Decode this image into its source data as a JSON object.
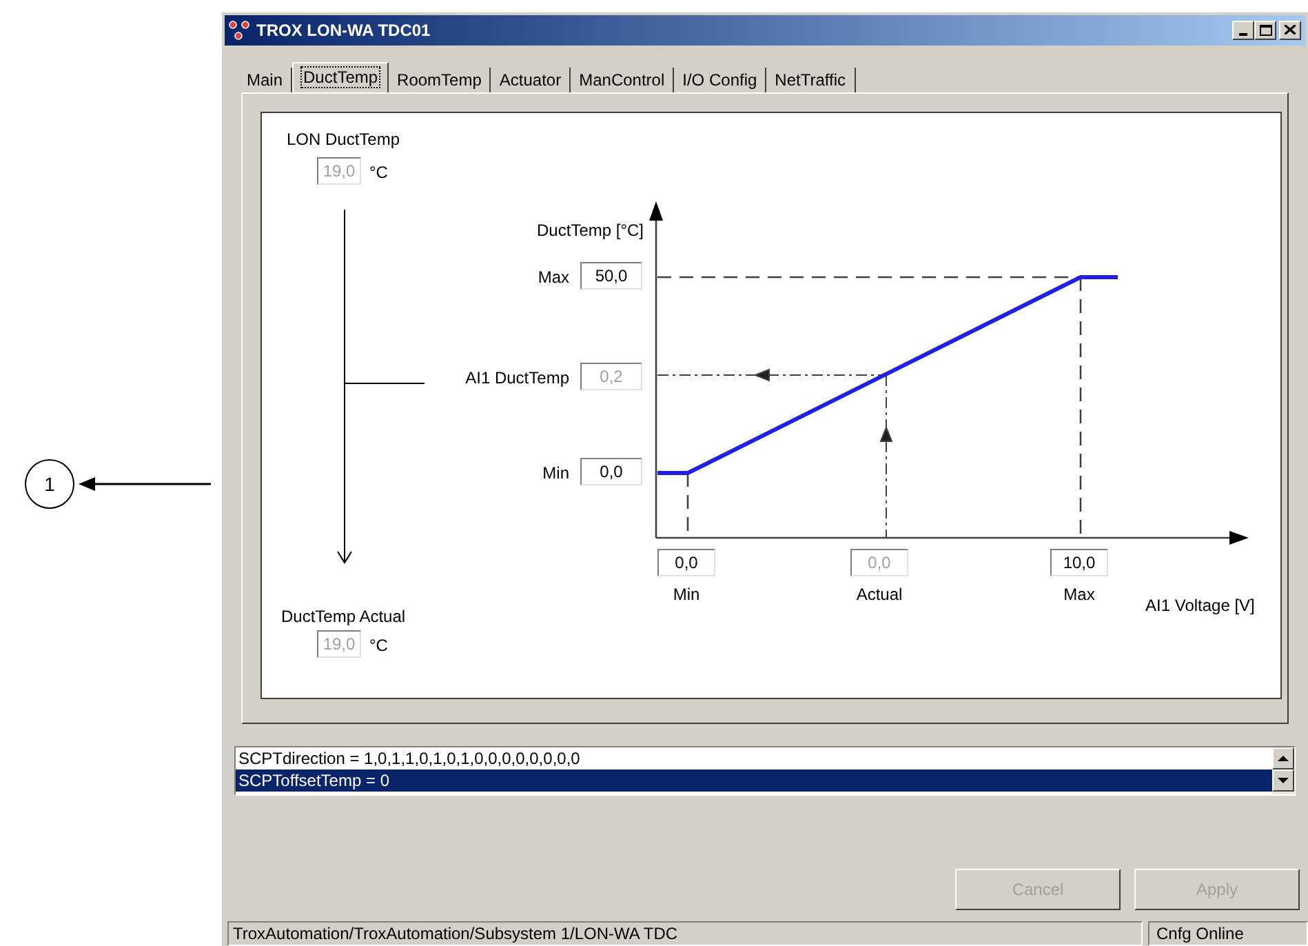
{
  "callout": {
    "label": "1"
  },
  "window": {
    "title": "TROX LON-WA TDC01"
  },
  "tabs": [
    {
      "label": "Main",
      "selected": false
    },
    {
      "label": "DuctTemp",
      "selected": true
    },
    {
      "label": "RoomTemp",
      "selected": false
    },
    {
      "label": "Actuator",
      "selected": false
    },
    {
      "label": "ManControl",
      "selected": false
    },
    {
      "label": "I/O Config",
      "selected": false
    },
    {
      "label": "NetTraffic",
      "selected": false
    }
  ],
  "duct_temp": {
    "lon": {
      "label": "LON DuctTemp",
      "value": "19,0",
      "unit": "°C",
      "disabled": true
    },
    "actual": {
      "label": "DuctTemp Actual",
      "value": "19,0",
      "unit": "°C",
      "disabled": true
    },
    "y_axis_label": "DuctTemp [°C]",
    "x_axis_label": "AI1 Voltage [V]",
    "y_fields": [
      {
        "label": "Max",
        "value": "50,0",
        "disabled": false
      },
      {
        "label": "AI1 DuctTemp",
        "value": "0,2",
        "disabled": true
      },
      {
        "label": "Min",
        "value": "0,0",
        "disabled": false
      }
    ],
    "x_fields": [
      {
        "label": "Min",
        "value": "0,0",
        "disabled": false
      },
      {
        "label": "Actual",
        "value": "0,0",
        "disabled": true
      },
      {
        "label": "Max",
        "value": "10,0",
        "disabled": false
      }
    ]
  },
  "properties": [
    {
      "text": "SCPTdirection = 1,0,1,1,0,1,0,1,0,0,0,0,0,0,0,0",
      "selected": false
    },
    {
      "text": "SCPToffsetTemp = 0",
      "selected": true
    }
  ],
  "buttons": [
    {
      "label": "Cancel",
      "disabled": true
    },
    {
      "label": "Apply",
      "disabled": true
    }
  ],
  "status_bar": {
    "path": "TroxAutomation/TroxAutomation/Subsystem 1/LON-WA TDC",
    "state": "Cnfg Online"
  }
}
